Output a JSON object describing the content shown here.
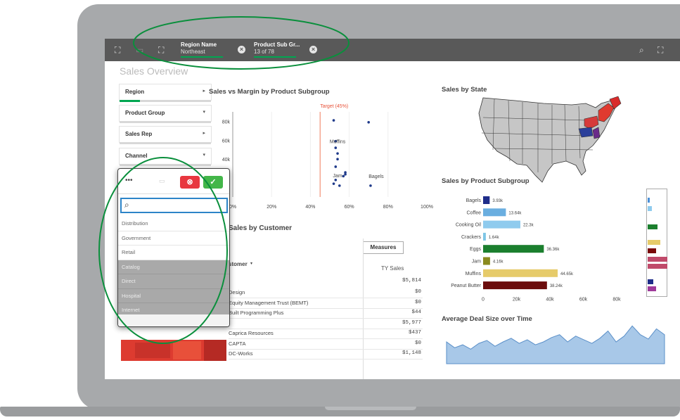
{
  "topbar": {
    "left_icons": [
      "select-icon",
      "back-icon",
      "forward-icon"
    ],
    "selections": [
      {
        "title": "Region Name",
        "value": "Northeast"
      },
      {
        "title": "Product Sub Gr...",
        "value": "13 of 78"
      }
    ],
    "right_icons": [
      "search-icon",
      "fullscreen-icon"
    ]
  },
  "page_title": "Sales Overview",
  "filters": [
    {
      "label": "Region",
      "fill": 0.22
    },
    {
      "label": "Product Group",
      "fill": 0.0
    },
    {
      "label": "Sales Rep",
      "fill": 0.0
    },
    {
      "label": "Channel",
      "fill": 0.0
    }
  ],
  "popup": {
    "dots": "•••",
    "search_placeholder": "",
    "cancel_icon": "close-icon",
    "confirm_icon": "check-icon",
    "items": [
      {
        "label": "Distribution",
        "state": "possible"
      },
      {
        "label": "Government",
        "state": "possible"
      },
      {
        "label": "Retail",
        "state": "possible"
      },
      {
        "label": "Catalog",
        "state": "excluded"
      },
      {
        "label": "Direct",
        "state": "excluded"
      },
      {
        "label": "Hospital",
        "state": "excluded"
      },
      {
        "label": "Internet",
        "state": "excluded"
      }
    ]
  },
  "scatter": {
    "title": "Sales vs Margin by Product Subgroup",
    "target_label": "Target (45%)",
    "y_ticks": [
      "80k",
      "60k",
      "40k"
    ],
    "x_ticks": [
      "0%",
      "20%",
      "40%",
      "60%",
      "80%",
      "100%"
    ],
    "point_labels": [
      "Muffins",
      "Jam",
      "Bagels"
    ],
    "chart_data": {
      "type": "scatter",
      "title": "Sales vs Margin by Product Subgroup",
      "target": 45,
      "x": [
        52,
        70,
        53,
        53,
        54,
        54,
        53,
        58,
        58,
        57,
        53,
        52,
        55,
        71
      ],
      "y": [
        81,
        79,
        59,
        52,
        46,
        40,
        32,
        26,
        24,
        22,
        18,
        14,
        12,
        12
      ],
      "labels": {
        "Muffins": [
          54,
          57
        ],
        "Jam": [
          54,
          21
        ],
        "Bagels": [
          70,
          20
        ]
      },
      "xlim": [
        0,
        100
      ],
      "ylim": [
        0,
        90
      ]
    }
  },
  "customers": {
    "title": "Sales by Customer",
    "measures_label": "Measures",
    "column_header": "stomer",
    "ty_header": "TY Sales",
    "total": "$5,814",
    "rows": [
      {
        "name": "Design",
        "value": "$0"
      },
      {
        "name": "Equity Management Trust (BEMT)",
        "value": "$0"
      },
      {
        "name": "Built Programming Plus",
        "value": "$44"
      },
      {
        "name": "",
        "value": "$5,977"
      },
      {
        "name": "Caprica Resources",
        "value": "$437"
      },
      {
        "name": "CAPTA",
        "value": "$0"
      },
      {
        "name": "DC-Works",
        "value": "$1,148"
      }
    ]
  },
  "map": {
    "title": "Sales by State"
  },
  "subgroup": {
    "title": "Sales by Product Subgroup",
    "x_ticks": [
      "0",
      "20k",
      "40k",
      "60k",
      "80k"
    ],
    "chart_data": {
      "type": "bar",
      "orientation": "horizontal",
      "categories": [
        "Bagels",
        "Coffee",
        "Cooking Oil",
        "Crackers",
        "Eggs",
        "Jam",
        "Muffins",
        "Peanut Butter"
      ],
      "values": [
        3.93,
        13.64,
        22.3,
        1.64,
        36.36,
        4.16,
        44.65,
        38.24
      ],
      "labels": [
        "3.93k",
        "13.64k",
        "22.3k",
        "1.64k",
        "36.36k",
        "4.16k",
        "44.65k",
        "38.24k"
      ],
      "colors": [
        "#1f2d8a",
        "#6aaee0",
        "#8fcbee",
        "#7ec6e6",
        "#1b7f2e",
        "#8a8a1e",
        "#e6cb6a",
        "#6b0c0c"
      ],
      "xlim": [
        0,
        80
      ]
    }
  },
  "mini_colors": [
    "#4a90d9",
    "#8fcbee",
    "#1b7f2e",
    "#e6cb6a",
    "#7a0a0a",
    "#c04a6a",
    "#c04a6a",
    "#1f2d8a",
    "#9f3a9a"
  ],
  "deal": {
    "title": "Average Deal Size over Time",
    "chart_data": {
      "type": "area",
      "values": [
        30,
        22,
        26,
        20,
        28,
        32,
        24,
        30,
        35,
        28,
        33,
        26,
        30,
        36,
        40,
        30,
        38,
        33,
        28,
        35,
        45,
        30,
        38,
        52,
        40,
        34,
        48,
        40
      ]
    }
  },
  "annotation_color": "#0a8f3c"
}
